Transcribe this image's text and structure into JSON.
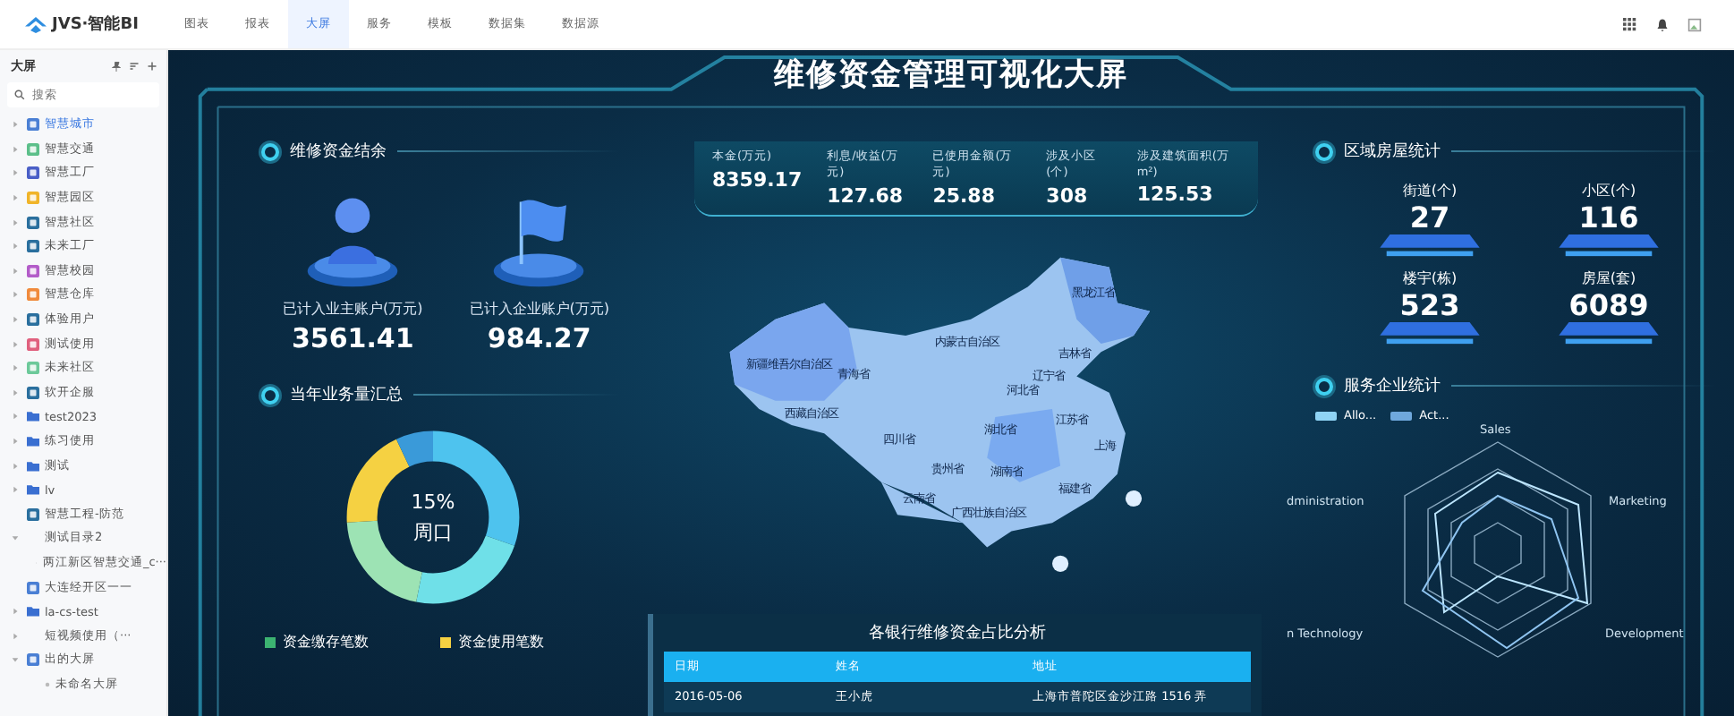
{
  "app": {
    "logo": "JVS·智能BI"
  },
  "nav": [
    {
      "label": "图表",
      "selected": false
    },
    {
      "label": "报表",
      "selected": false
    },
    {
      "label": "大屏",
      "selected": true
    },
    {
      "label": "服务",
      "selected": false
    },
    {
      "label": "模板",
      "selected": false
    },
    {
      "label": "数据集",
      "selected": false
    },
    {
      "label": "数据源",
      "selected": false
    }
  ],
  "sidebar": {
    "title": "大屏",
    "search": {
      "placeholder": "搜索"
    },
    "items": [
      {
        "label": "智慧城市",
        "kind": "app",
        "color": "#4a7fd4",
        "selected": true,
        "expanded": false
      },
      {
        "label": "智慧交通",
        "kind": "app",
        "color": "#5cbf8a",
        "selected": false,
        "expanded": false
      },
      {
        "label": "智慧工厂",
        "kind": "app",
        "color": "#4a5fc7",
        "selected": false,
        "expanded": false
      },
      {
        "label": "智慧园区",
        "kind": "app",
        "color": "#f0b429",
        "selected": false,
        "expanded": false
      },
      {
        "label": "智慧社区",
        "kind": "app",
        "color": "#2a6f9e",
        "selected": false,
        "expanded": false
      },
      {
        "label": "未来工厂",
        "kind": "app",
        "color": "#2a6f9e",
        "selected": false,
        "expanded": false
      },
      {
        "label": "智慧校园",
        "kind": "app",
        "color": "#b35cc9",
        "selected": false,
        "expanded": false
      },
      {
        "label": "智慧仓库",
        "kind": "app",
        "color": "#f08a3c",
        "selected": false,
        "expanded": false
      },
      {
        "label": "体验用户",
        "kind": "app",
        "color": "#2a6f9e",
        "selected": false,
        "expanded": false
      },
      {
        "label": "测试使用",
        "kind": "app",
        "color": "#e0607e",
        "selected": false,
        "expanded": false
      },
      {
        "label": "未来社区",
        "kind": "app",
        "color": "#6cc99a",
        "selected": false,
        "expanded": false
      },
      {
        "label": "软开企服",
        "kind": "app",
        "color": "#2a6f9e",
        "selected": false,
        "expanded": false
      },
      {
        "label": "test2023",
        "kind": "folder",
        "color": "#3a6fd1",
        "selected": false,
        "expanded": false
      },
      {
        "label": "练习使用",
        "kind": "folder",
        "color": "#3a6fd1",
        "selected": false,
        "expanded": false
      },
      {
        "label": "测试",
        "kind": "folder",
        "color": "#3a6fd1",
        "selected": false,
        "expanded": false
      },
      {
        "label": "lv",
        "kind": "folder",
        "color": "#3a6fd1",
        "selected": false,
        "expanded": false
      },
      {
        "label": "智慧工程-防范",
        "kind": "file",
        "color": "#2a6f9e",
        "selected": false
      },
      {
        "label": "测试目录2",
        "kind": "group",
        "selected": false,
        "expanded": true,
        "children": [
          {
            "label": "两江新区智慧交通_c···",
            "kind": "page",
            "selected": false
          }
        ]
      },
      {
        "label": "大连经开区一一",
        "kind": "file",
        "color": "#4a7fd4",
        "selected": false
      },
      {
        "label": "la-cs-test",
        "kind": "folder",
        "color": "#3a6fd1",
        "selected": false,
        "expanded": false
      },
      {
        "label": "短视频使用（···",
        "kind": "group",
        "selected": false,
        "expanded": false
      },
      {
        "label": "出的大屏",
        "kind": "app",
        "color": "#4a7fd4",
        "selected": false,
        "expanded": true,
        "children": [
          {
            "label": "未命名大屏",
            "kind": "page",
            "selected": false
          }
        ]
      }
    ]
  },
  "dashboard": {
    "title": "维修资金管理可视化大屏",
    "balance": {
      "title": "维修资金结余",
      "cards": [
        {
          "kind": "person",
          "label": "已计入业主账户(万元)",
          "value": "3561.41"
        },
        {
          "kind": "flag",
          "label": "已计入企业账户(万元)",
          "value": "984.27"
        }
      ]
    },
    "stats": [
      {
        "label": "本金(万元)",
        "value": "8359.17"
      },
      {
        "label": "利息/收益(万元)",
        "value": "127.68"
      },
      {
        "label": "已使用金额(万元)",
        "value": "25.88"
      },
      {
        "label": "涉及小区(个)",
        "value": "308"
      },
      {
        "label": "涉及建筑面积(万m²)",
        "value": "125.53"
      }
    ],
    "business": {
      "title": "当年业务量汇总",
      "donut_value": "15%",
      "donut_label": "周口",
      "legend": [
        {
          "label": "资金缴存笔数",
          "color": "#3cb371"
        },
        {
          "label": "资金使用笔数",
          "color": "#f5d142"
        }
      ]
    },
    "map_labels": [
      "新疆维吾尔自治区",
      "西藏自治区",
      "青海省",
      "内蒙古自治区",
      "黑龙江省",
      "吉林省",
      "辽宁省",
      "河北省",
      "四川省",
      "湖北省",
      "贵州省",
      "湖南省",
      "云南省",
      "广西壮族自治区",
      "江苏省",
      "福建省",
      "上海"
    ],
    "housing": {
      "title": "区域房屋统计",
      "items": [
        {
          "label": "街道(个)",
          "value": "27"
        },
        {
          "label": "小区(个)",
          "value": "116"
        },
        {
          "label": "楼宇(栋)",
          "value": "523"
        },
        {
          "label": "房屋(套)",
          "value": "6089"
        }
      ]
    },
    "enterprise": {
      "title": "服务企业统计",
      "legend": [
        {
          "label": "Allo...",
          "color": "#8fd3f4"
        },
        {
          "label": "Act...",
          "color": "#6fa8dc"
        }
      ],
      "axes": [
        "Sales",
        "dministration",
        "Marketing",
        "n Technology",
        "Development"
      ]
    },
    "table": {
      "title": "各银行维修资金占比分析",
      "columns": [
        "日期",
        "姓名",
        "地址"
      ],
      "rows": [
        [
          "2016-05-06",
          "王小虎",
          "上海市普陀区金沙江路 1516 弄"
        ]
      ]
    }
  }
}
